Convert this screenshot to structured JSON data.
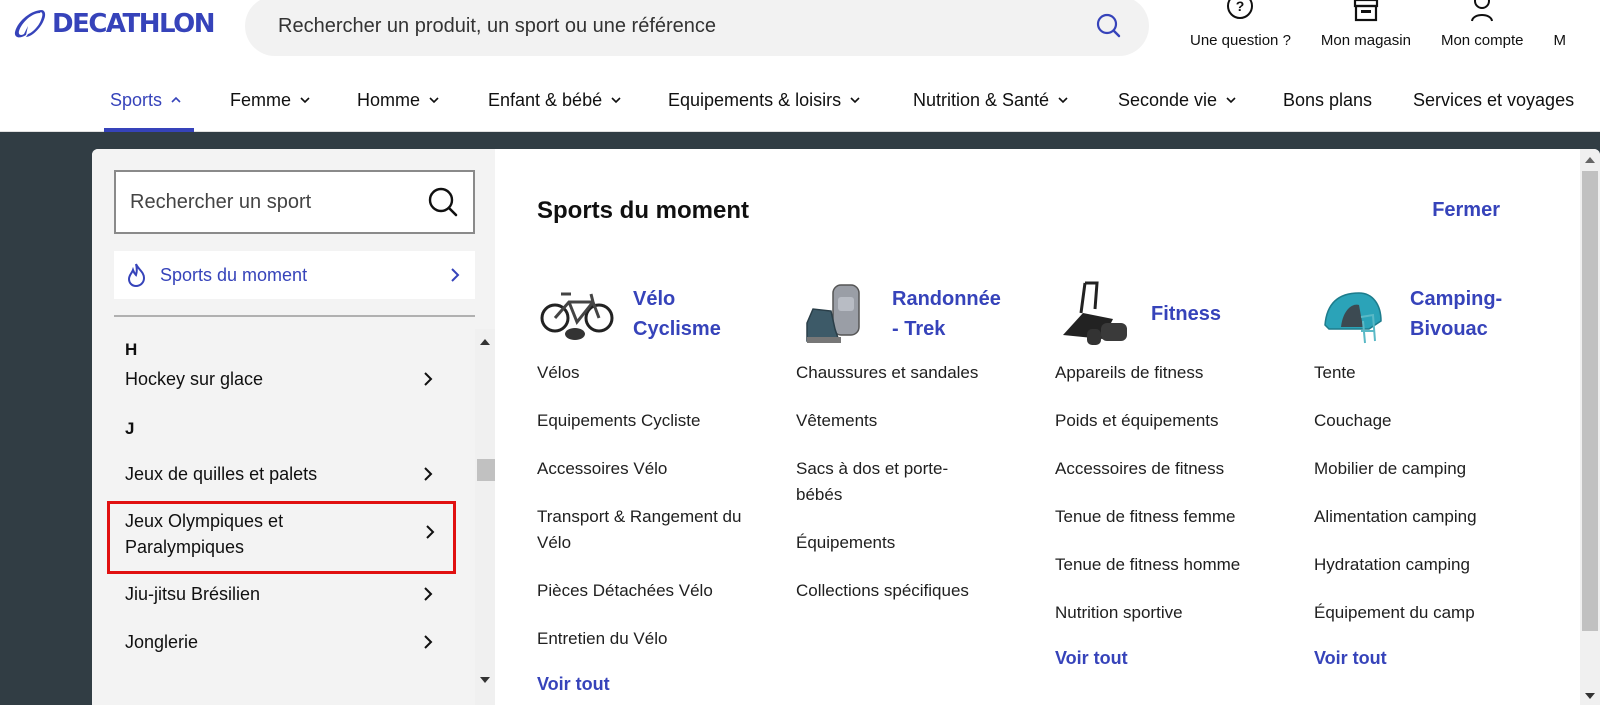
{
  "brand": {
    "name": "DECATHLON",
    "color": "#3643ba"
  },
  "search": {
    "placeholder": "Rechercher un produit, un sport ou une référence",
    "icon": "search-icon"
  },
  "top_actions": [
    {
      "label": "Une question ?",
      "icon": "help-circle-icon"
    },
    {
      "label": "Mon magasin",
      "icon": "store-icon"
    },
    {
      "label": "Mon compte",
      "icon": "user-icon"
    },
    {
      "label": "M",
      "icon": ""
    }
  ],
  "nav": [
    {
      "label": "Sports",
      "chevron": "up",
      "active": true
    },
    {
      "label": "Femme",
      "chevron": "down"
    },
    {
      "label": "Homme",
      "chevron": "down"
    },
    {
      "label": "Enfant & bébé",
      "chevron": "down"
    },
    {
      "label": "Equipements & loisirs",
      "chevron": "down"
    },
    {
      "label": "Nutrition & Santé",
      "chevron": "down"
    },
    {
      "label": "Seconde vie",
      "chevron": "down"
    },
    {
      "label": "Bons plans"
    },
    {
      "label": "Services et voyages"
    }
  ],
  "sidebar": {
    "search_placeholder": "Rechercher un sport",
    "moment_label": "Sports du moment",
    "groups": [
      {
        "letter": "H",
        "items": [
          "Hockey sur glace"
        ]
      },
      {
        "letter": "J",
        "items": [
          "Jeux de quilles et palets",
          "Jeux Olympiques et Paralympiques",
          "Jiu-jitsu Brésilien",
          "Jonglerie"
        ]
      }
    ],
    "highlighted_item": "Jeux Olympiques et Paralympiques"
  },
  "content": {
    "title": "Sports du moment",
    "close_label": "Fermer",
    "columns": [
      {
        "title": "Vélo Cyclisme",
        "image": "bike-image",
        "items": [
          "Vélos",
          "Equipements Cycliste",
          "Accessoires Vélo",
          "Transport & Rangement du Vélo",
          "Pièces Détachées Vélo",
          "Entretien du Vélo"
        ],
        "more": "Voir tout"
      },
      {
        "title": "Randonnée - Trek",
        "image": "hiking-gear-image",
        "items": [
          "Chaussures et sandales",
          "Vêtements",
          "Sacs à dos et porte-bébés",
          "Équipements",
          "Collections spécifiques"
        ]
      },
      {
        "title": "Fitness",
        "image": "fitness-gear-image",
        "items": [
          "Appareils de fitness",
          "Poids et équipements",
          "Accessoires de fitness",
          "Tenue de fitness femme",
          "Tenue de fitness homme",
          "Nutrition sportive"
        ],
        "more": "Voir tout"
      },
      {
        "title": "Camping-Bivouac",
        "image": "tent-image",
        "items": [
          "Tente",
          "Couchage",
          "Mobilier de camping",
          "Alimentation camping",
          "Hydratation camping",
          "Équipement du camp"
        ],
        "more": "Voir tout"
      }
    ]
  }
}
